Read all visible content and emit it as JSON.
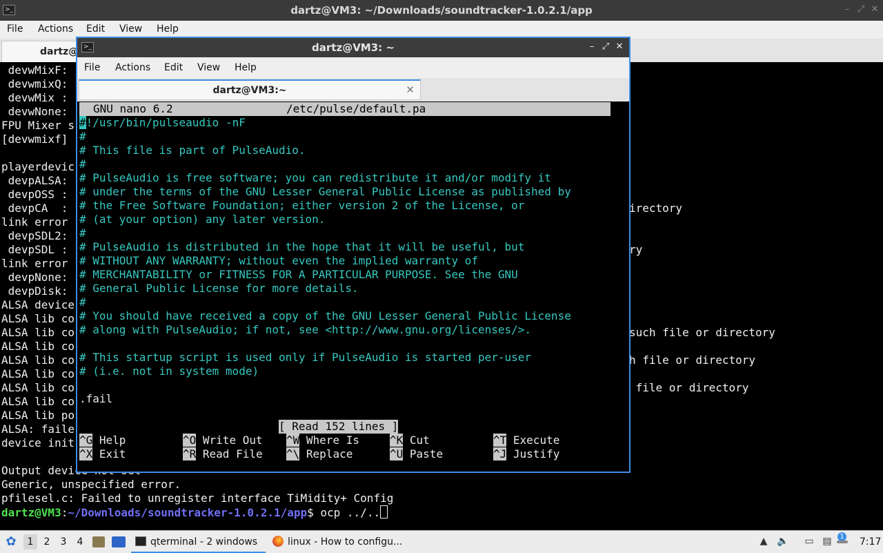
{
  "back_window": {
    "title": "dartz@VM3: ~/Downloads/soundtracker-1.0.2.1/app",
    "menu": [
      "File",
      "Actions",
      "Edit",
      "View",
      "Help"
    ],
    "tab_label": "dartz@",
    "lines": [
      " devwMixF:",
      " devwmixQ:",
      " devwMix :",
      " devwNone:",
      "FPU Mixer s",
      "[devwmixf]",
      "",
      "playerdevic",
      " devpALSA:",
      " devpOSS :",
      " devpCA  :",
      "link error",
      " devpSDL2:",
      " devpSDL :",
      "link error",
      " devpNone:",
      " devpDisk:",
      "ALSA device",
      "ALSA lib co",
      "ALSA lib co",
      "ALSA lib co",
      "ALSA lib co",
      "ALSA lib co",
      "ALSA lib co",
      "ALSA lib co",
      "ALSA lib po",
      "ALSA: faile",
      "device init",
      "",
      "Output device not set",
      "Generic, unspecified error.",
      "pfilesel.c: Failed to unregister interface TiMidity+ Config"
    ],
    "right_fragments": [
      {
        "row": 10,
        "text": "irectory"
      },
      {
        "row": 13,
        "text": "ry"
      },
      {
        "row": 19,
        "text": "such file or directory"
      },
      {
        "row": 21,
        "text": "h file or directory"
      },
      {
        "row": 23,
        "text": " file or directory"
      }
    ],
    "prompt_user": "dartz@VM3",
    "prompt_sep": ":",
    "prompt_path": "~/Downloads/soundtracker-1.0.2.1/app",
    "prompt_cmd": "$ ocp ../.."
  },
  "front_window": {
    "title": "dartz@VM3: ~",
    "menu": [
      "File",
      "Actions",
      "Edit",
      "View",
      "Help"
    ],
    "tab_label": "dartz@VM3:~",
    "nano": {
      "version": "GNU nano 6.2",
      "filename": "/etc/pulse/default.pa",
      "lines": [
        "#!/usr/bin/pulseaudio -nF",
        "#",
        "# This file is part of PulseAudio.",
        "#",
        "# PulseAudio is free software; you can redistribute it and/or modify it",
        "# under the terms of the GNU Lesser General Public License as published by",
        "# the Free Software Foundation; either version 2 of the License, or",
        "# (at your option) any later version.",
        "#",
        "# PulseAudio is distributed in the hope that it will be useful, but",
        "# WITHOUT ANY WARRANTY; without even the implied warranty of",
        "# MERCHANTABILITY or FITNESS FOR A PARTICULAR PURPOSE. See the GNU",
        "# General Public License for more details.",
        "#",
        "# You should have received a copy of the GNU Lesser General Public License",
        "# along with PulseAudio; if not, see <http://www.gnu.org/licenses/>.",
        "",
        "# This startup script is used only if PulseAudio is started per-user",
        "# (i.e. not in system mode)",
        "",
        ".fail"
      ],
      "status": "[ Read 152 lines ]",
      "shortcuts": [
        {
          "key": "^G",
          "label": "Help"
        },
        {
          "key": "^O",
          "label": "Write Out"
        },
        {
          "key": "^W",
          "label": "Where Is"
        },
        {
          "key": "^K",
          "label": "Cut"
        },
        {
          "key": "^T",
          "label": "Execute"
        },
        {
          "key": "^X",
          "label": "Exit"
        },
        {
          "key": "^R",
          "label": "Read File"
        },
        {
          "key": "^\\",
          "label": "Replace"
        },
        {
          "key": "^U",
          "label": "Paste"
        },
        {
          "key": "^J",
          "label": "Justify"
        }
      ]
    }
  },
  "taskbar": {
    "workspaces": [
      "1",
      "2",
      "3",
      "4"
    ],
    "tasks": [
      {
        "label": "qterminal - 2 windows",
        "icon": "terminal-icon"
      },
      {
        "label": "linux - How to configu...",
        "icon": "firefox-icon"
      }
    ],
    "clock": "7:17",
    "notification_count": "1",
    "accent": "#3d8ee6"
  }
}
